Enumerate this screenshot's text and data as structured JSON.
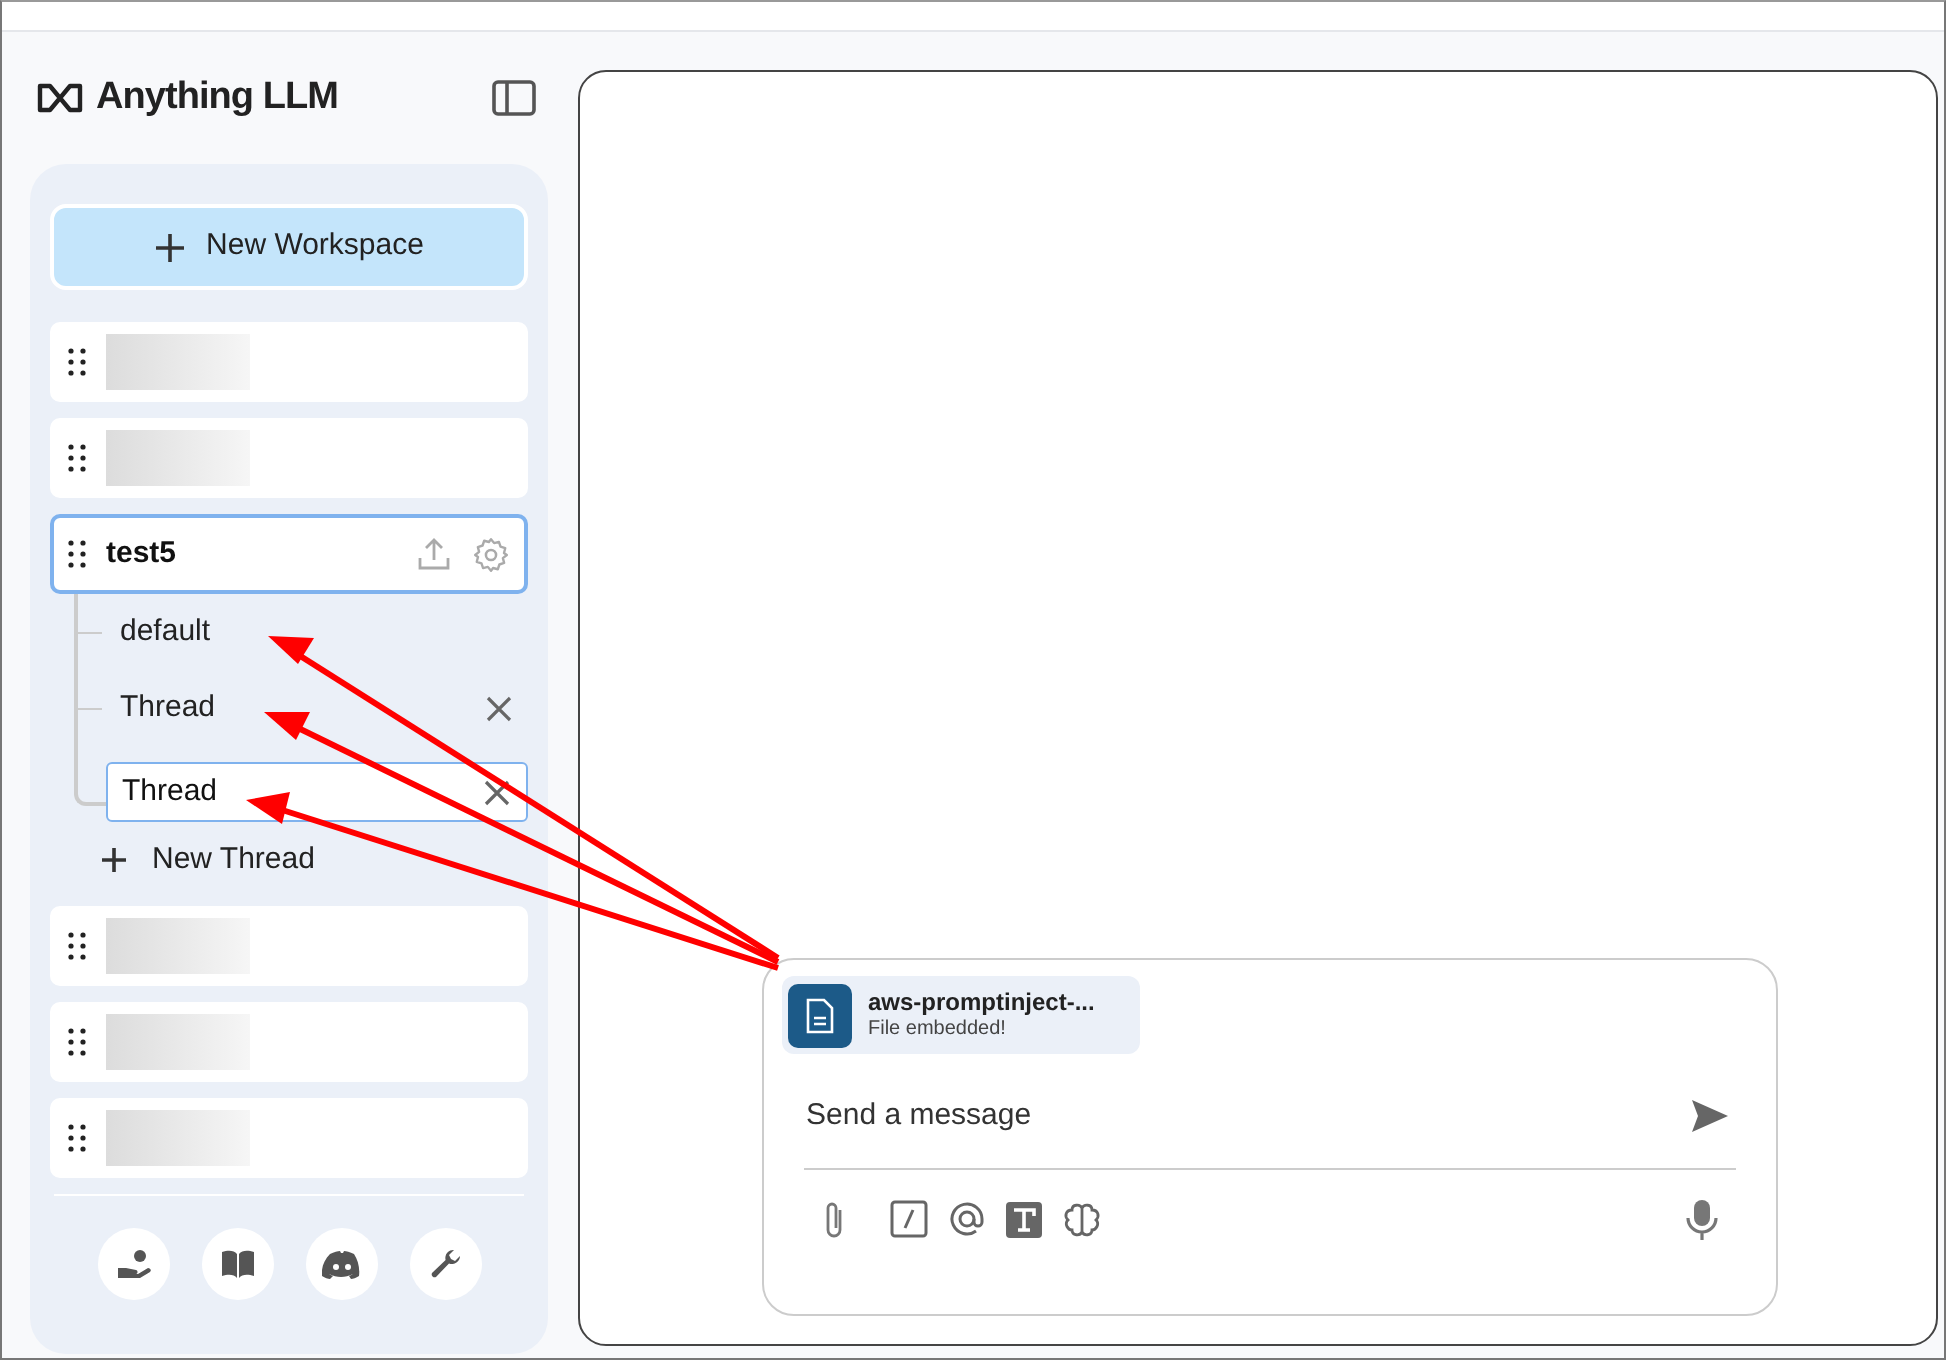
{
  "app": {
    "logo_text": "Anything LLM"
  },
  "sidebar": {
    "new_workspace_label": "New Workspace",
    "workspaces": [
      {
        "kind": "redacted",
        "selected": false
      },
      {
        "kind": "redacted",
        "selected": false
      },
      {
        "kind": "named",
        "name": "test5",
        "selected": true,
        "threads": [
          {
            "label": "default",
            "selected": false,
            "deletable": false
          },
          {
            "label": "Thread",
            "selected": false,
            "deletable": true
          },
          {
            "label": "Thread",
            "selected": true,
            "deletable": true
          }
        ],
        "new_thread_label": "New Thread"
      },
      {
        "kind": "redacted",
        "selected": false
      },
      {
        "kind": "redacted",
        "selected": false
      },
      {
        "kind": "redacted",
        "selected": false
      }
    ]
  },
  "chat": {
    "attachment": {
      "file_name": "aws-promptinject-...",
      "status": "File embedded!"
    },
    "placeholder": "Send a message"
  }
}
